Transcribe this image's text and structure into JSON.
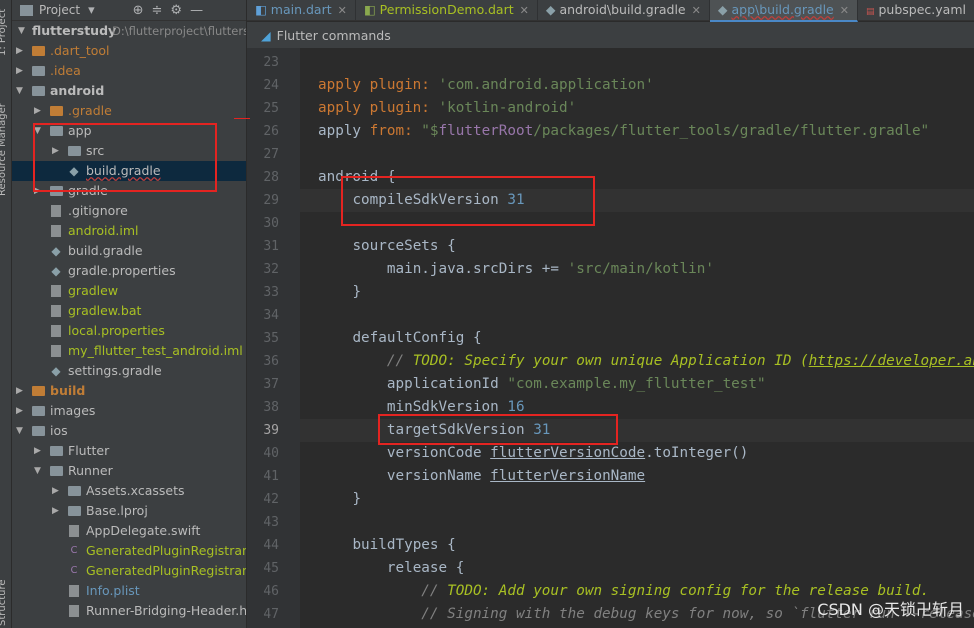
{
  "sidebar_tabs": [
    "1: Project",
    "Resource Manager",
    "Structure"
  ],
  "project_panel": {
    "title": "Project",
    "root": {
      "name": "flutterstudy",
      "path": "D:\\flutterproject\\flutterstudy"
    },
    "items": [
      {
        "label": ".dart_tool",
        "kind": "folder-orange"
      },
      {
        "label": ".idea",
        "kind": "folder"
      },
      {
        "label": "android",
        "kind": "folder"
      },
      {
        "label": ".gradle",
        "kind": "folder-orange"
      },
      {
        "label": "app",
        "kind": "folder"
      },
      {
        "label": "src",
        "kind": "folder"
      },
      {
        "label": "build.gradle",
        "kind": "gradle"
      },
      {
        "label": "gradle",
        "kind": "folder"
      },
      {
        "label": ".gitignore",
        "kind": "file"
      },
      {
        "label": "android.iml",
        "kind": "file"
      },
      {
        "label": "build.gradle",
        "kind": "gradle"
      },
      {
        "label": "gradle.properties",
        "kind": "gradle"
      },
      {
        "label": "gradlew",
        "kind": "file"
      },
      {
        "label": "gradlew.bat",
        "kind": "file"
      },
      {
        "label": "local.properties",
        "kind": "file"
      },
      {
        "label": "my_fllutter_test_android.iml",
        "kind": "file"
      },
      {
        "label": "settings.gradle",
        "kind": "gradle"
      },
      {
        "label": "build",
        "kind": "folder-orange"
      },
      {
        "label": "images",
        "kind": "folder"
      },
      {
        "label": "ios",
        "kind": "folder"
      },
      {
        "label": "Flutter",
        "kind": "folder"
      },
      {
        "label": "Runner",
        "kind": "folder"
      },
      {
        "label": "Assets.xcassets",
        "kind": "folder"
      },
      {
        "label": "Base.lproj",
        "kind": "folder"
      },
      {
        "label": "AppDelegate.swift",
        "kind": "swift"
      },
      {
        "label": "GeneratedPluginRegistrant.h",
        "kind": "cfile"
      },
      {
        "label": "GeneratedPluginRegistrant.m",
        "kind": "cfile"
      },
      {
        "label": "Info.plist",
        "kind": "file"
      },
      {
        "label": "Runner-Bridging-Header.h",
        "kind": "cfile"
      }
    ]
  },
  "editor_tabs": [
    {
      "label": "main.dart"
    },
    {
      "label": "PermissionDemo.dart"
    },
    {
      "label": "android\\build.gradle"
    },
    {
      "label": "app\\build.gradle"
    },
    {
      "label": "pubspec.yaml"
    }
  ],
  "banner": {
    "text": "Flutter commands"
  },
  "line_numbers": [
    "23",
    "24",
    "25",
    "26",
    "27",
    "28",
    "29",
    "30",
    "31",
    "32",
    "33",
    "34",
    "35",
    "36",
    "37",
    "38",
    "39",
    "40",
    "41",
    "42",
    "43",
    "44",
    "45",
    "46",
    "47"
  ],
  "code": {
    "l24": {
      "kw": "apply plugin:",
      "str": "'com.android.application'"
    },
    "l25": {
      "kw": "apply plugin:",
      "str": "'kotlin-android'"
    },
    "l26": {
      "a": "apply ",
      "kw": "from:",
      "str1": " \"$",
      "var": "flutterRoot",
      "str2": "/packages/flutter_tools/gradle/flutter.gradle\""
    },
    "l28": "android {",
    "l29": {
      "t": "compileSdkVersion ",
      "n": "31"
    },
    "l31": "sourceSets {",
    "l32": {
      "t": "main.java.srcDirs += ",
      "s": "'src/main/kotlin'"
    },
    "l33": "}",
    "l35": "defaultConfig {",
    "l36": {
      "c": "// ",
      "todo": "TODO: Specify your own unique Application ID (",
      "link": "https://developer.android.com/studio/build/application-id.html",
      "end": ")."
    },
    "l37": {
      "t": "applicationId ",
      "s": "\"com.example.my_fllutter_test\""
    },
    "l38": {
      "t": "minSdkVersion ",
      "n": "16"
    },
    "l39": {
      "t": "targetSdkVersion ",
      "n": "31"
    },
    "l40": {
      "t": "versionCode ",
      "p": "flutterVersionCode",
      "e": ".toInteger()"
    },
    "l41": {
      "t": "versionName ",
      "p": "flutterVersionName"
    },
    "l42": "}",
    "l44": "buildTypes {",
    "l45": "release {",
    "l46": {
      "c": "// ",
      "todo": "TODO: Add your own signing config for the release build."
    },
    "l47": "// Signing with the debug keys for now, so `flutter run --release` works."
  },
  "watermark": "CSDN @天锁卍斩月"
}
